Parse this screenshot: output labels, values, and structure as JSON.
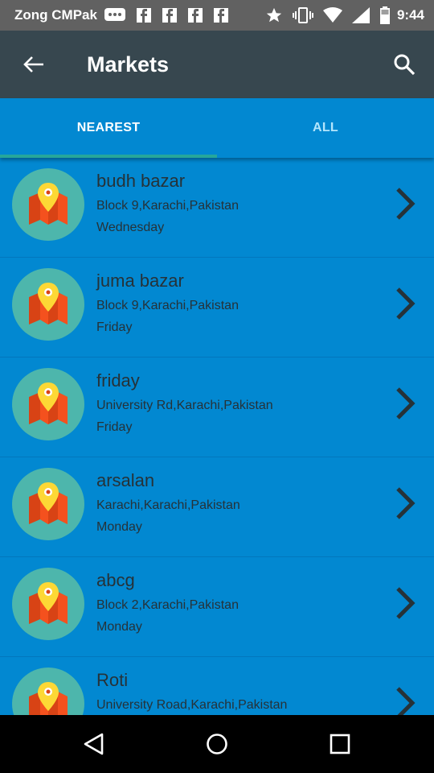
{
  "status_bar": {
    "carrier": "Zong CMPak",
    "time": "9:44",
    "icons_left": [
      "message-icon",
      "facebook-icon",
      "facebook-icon",
      "facebook-icon",
      "facebook-icon"
    ],
    "icons_right": [
      "star-icon",
      "vibrate-icon",
      "wifi-icon",
      "signal-icon",
      "battery-icon"
    ]
  },
  "app_bar": {
    "title": "Markets",
    "back_icon": "arrow-back-icon",
    "search_icon": "search-icon"
  },
  "tabs": [
    {
      "label": "NEAREST",
      "active": true
    },
    {
      "label": "ALL",
      "active": false
    }
  ],
  "markets": [
    {
      "name": "budh bazar",
      "address": "Block 9,Karachi,Pakistan",
      "day": "Wednesday"
    },
    {
      "name": "juma bazar",
      "address": "Block 9,Karachi,Pakistan",
      "day": "Friday"
    },
    {
      "name": "friday",
      "address": "University Rd,Karachi,Pakistan",
      "day": "Friday"
    },
    {
      "name": "arsalan",
      "address": "Karachi,Karachi,Pakistan",
      "day": "Monday"
    },
    {
      "name": "abcg",
      "address": "Block 2,Karachi,Pakistan",
      "day": "Monday"
    },
    {
      "name": "Roti",
      "address": "University Road,Karachi,Pakistan",
      "day": ""
    }
  ],
  "nav": {
    "back_icon": "nav-back-icon",
    "home_icon": "nav-home-icon",
    "recents_icon": "nav-recents-icon"
  },
  "colors": {
    "status_bar": "#616161",
    "app_bar": "#37474f",
    "primary": "#0288d1",
    "tab_indicator": "#26a69a",
    "avatar_bg": "#4db6ac",
    "text_dark": "#263238"
  }
}
